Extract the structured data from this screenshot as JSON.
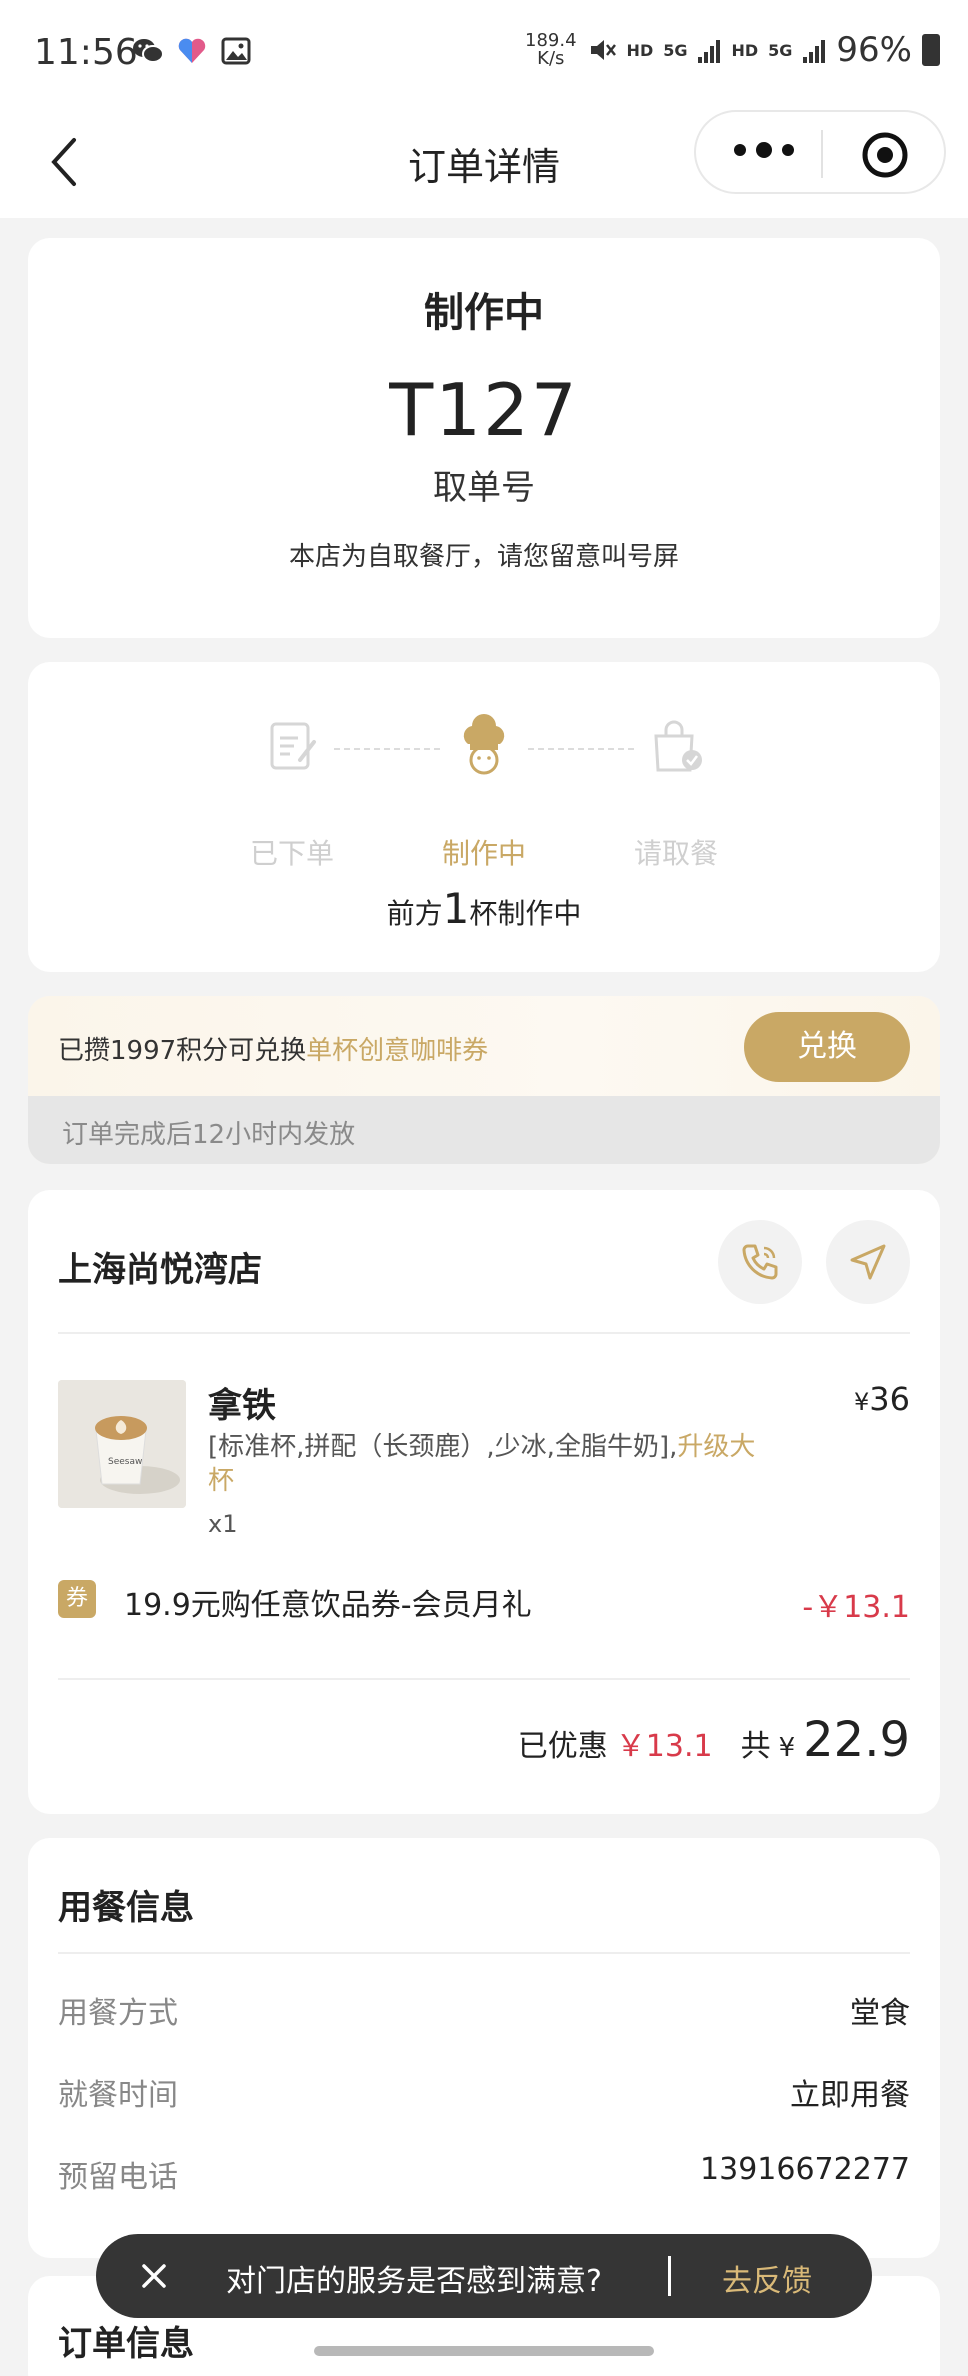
{
  "status_bar": {
    "time": "11:56",
    "net_speed_top": "189.4",
    "net_speed_bottom": "K/s",
    "sig1": "HD",
    "sig2": "5G",
    "sig3": "HD",
    "sig4": "5G",
    "battery": "96%"
  },
  "nav": {
    "title": "订单详情"
  },
  "order_status": {
    "title": "制作中",
    "pickup_number": "T127",
    "pickup_label": "取单号",
    "hint": "本店为自取餐厅，请您留意叫号屏"
  },
  "progress": {
    "steps": [
      {
        "label": "已下单",
        "icon": "order-placed-icon"
      },
      {
        "label": "制作中",
        "icon": "chef-hat-icon"
      },
      {
        "label": "请取餐",
        "icon": "pickup-bag-icon"
      }
    ],
    "active_step": 1,
    "queue_prefix": "前方",
    "queue_count": "1",
    "queue_suffix": "杯制作中"
  },
  "points": {
    "text": "已攒1997积分可兑换",
    "highlight": "单杯创意咖啡券",
    "button": "兑换",
    "note": "订单完成后12小时内发放"
  },
  "store": {
    "name": "上海尚悦湾店"
  },
  "item": {
    "name": "拿铁",
    "currency": "¥",
    "price": "36",
    "spec": "[标准杯,拼配（长颈鹿）,少冰,全脂牛奶],",
    "spec_highlight": "升级大杯",
    "qty": "x1"
  },
  "coupon": {
    "tag": "券",
    "name": "19.9元购任意饮品券-会员月礼",
    "amount": "-￥13.1"
  },
  "totals": {
    "discount_label": "已优惠",
    "discount": "￥13.1",
    "total_label": "共",
    "currency": "¥",
    "total": "22.9"
  },
  "dining": {
    "title": "用餐信息",
    "rows": [
      {
        "key": "用餐方式",
        "value": "堂食"
      },
      {
        "key": "就餐时间",
        "value": "立即用餐"
      },
      {
        "key": "预留电话",
        "value": "13916672277"
      }
    ]
  },
  "order_info": {
    "title": "订单信息"
  },
  "toast": {
    "message": "对门店的服务是否感到满意?",
    "link": "去反馈"
  },
  "colors": {
    "accent_gold": "#c9a865",
    "price_red": "#d83a4a",
    "toast_bg": "#353535"
  }
}
